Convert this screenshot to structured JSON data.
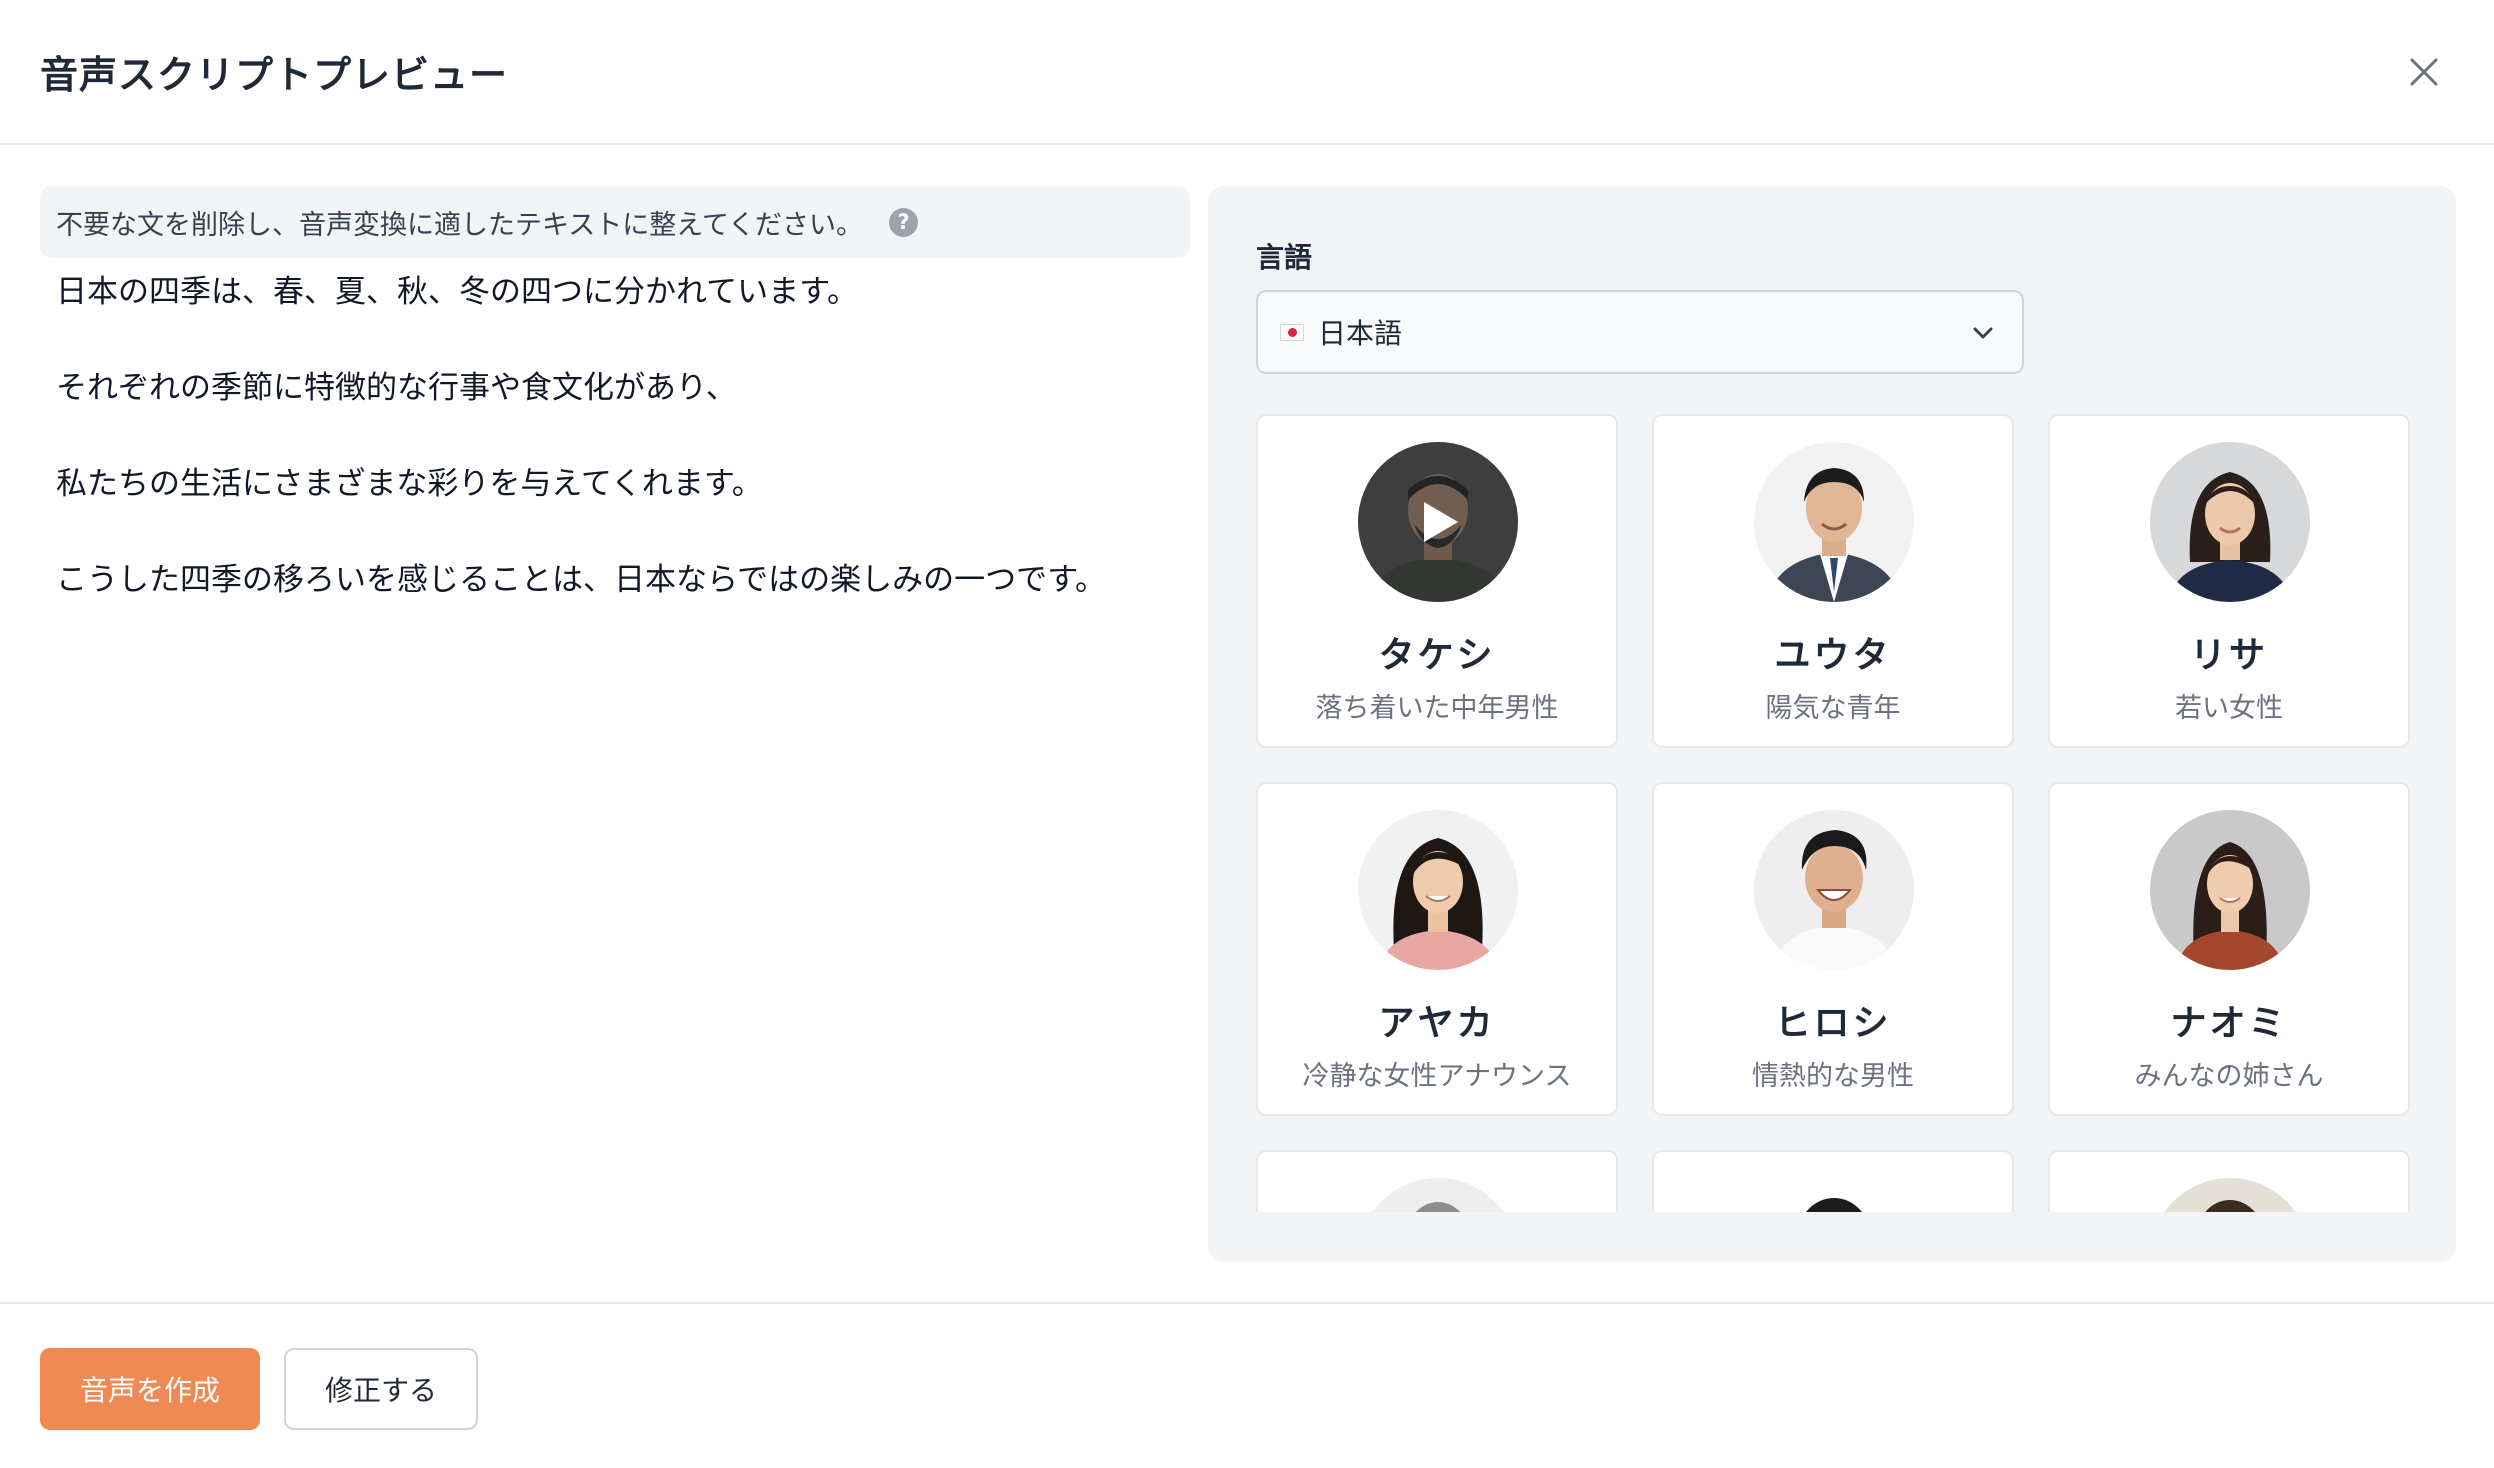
{
  "dialog": {
    "title": "音声スクリプトプレビュー"
  },
  "instruction": {
    "text": "不要な文を削除し、音声変換に適したテキストに整えてください。",
    "help_glyph": "?"
  },
  "script_lines": [
    "日本の四季は、春、夏、秋、冬の四つに分かれています。",
    "それぞれの季節に特徴的な行事や食文化があり、",
    "私たちの生活にさまざまな彩りを与えてくれます。",
    "こうした四季の移ろいを感じることは、日本ならではの楽しみの一つです。"
  ],
  "language": {
    "label": "言語",
    "selected": "日本語",
    "flag_icon": "japan-flag-icon"
  },
  "voices": [
    {
      "name": "タケシ",
      "desc": "落ち着いた中年男性",
      "playing": true
    },
    {
      "name": "ユウタ",
      "desc": "陽気な青年",
      "playing": false
    },
    {
      "name": "リサ",
      "desc": "若い女性",
      "playing": false
    },
    {
      "name": "アヤカ",
      "desc": "冷静な女性アナウンス",
      "playing": false
    },
    {
      "name": "ヒロシ",
      "desc": "情熱的な男性",
      "playing": false
    },
    {
      "name": "ナオミ",
      "desc": "みんなの姉さん",
      "playing": false
    }
  ],
  "footer": {
    "create_label": "音声を作成",
    "edit_label": "修正する"
  },
  "colors": {
    "accent": "#ef8a55",
    "panel_bg": "#f3f4f6"
  }
}
